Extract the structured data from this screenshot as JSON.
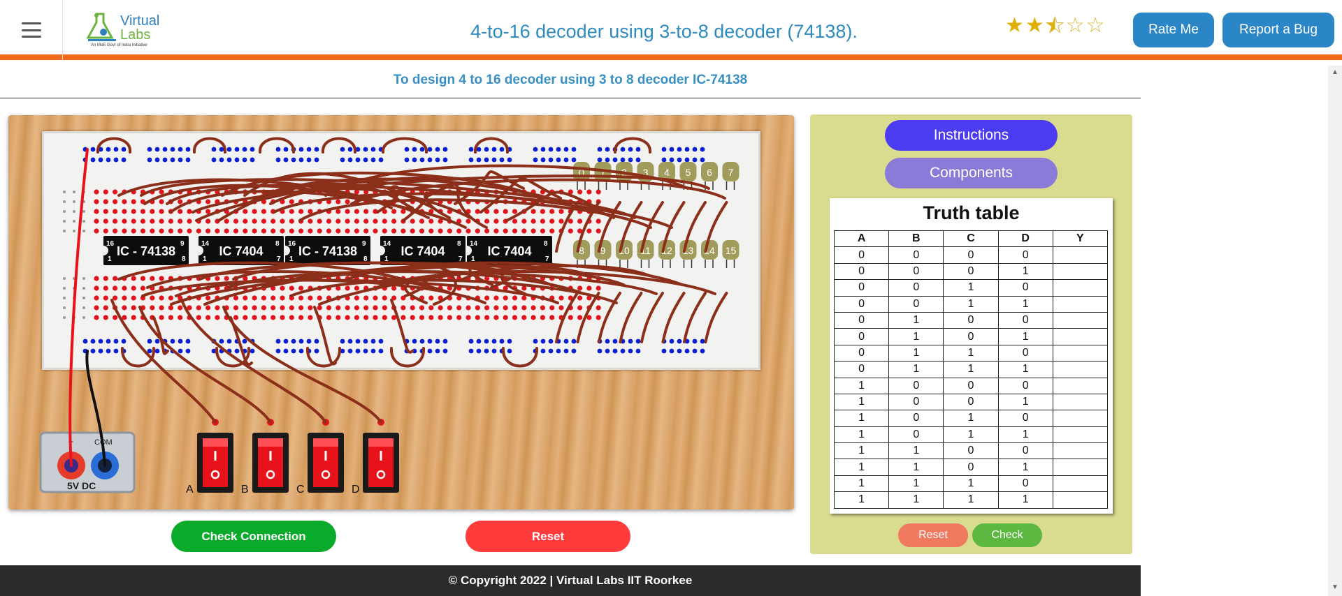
{
  "header": {
    "brand_line1": "Virtual",
    "brand_line2": "Labs",
    "brand_tagline": "An MoE Govt of India Initiative",
    "title": "4-to-16 decoder using 3-to-8 decoder (74138).",
    "rating": 2.5,
    "rating_max": 5,
    "rate_label": "Rate Me",
    "bug_label": "Report a Bug"
  },
  "aim": "To design 4 to 16 decoder using 3 to 8 decoder IC-74138",
  "chips": [
    {
      "label": "IC - 74138",
      "pin_tl": "16",
      "pin_bl": "1",
      "pin_tr": "9",
      "pin_br": "8"
    },
    {
      "label": "IC 7404",
      "pin_tl": "14",
      "pin_bl": "1",
      "pin_tr": "8",
      "pin_br": "7"
    },
    {
      "label": "IC - 74138",
      "pin_tl": "16",
      "pin_bl": "1",
      "pin_tr": "9",
      "pin_br": "8"
    },
    {
      "label": "IC 7404",
      "pin_tl": "14",
      "pin_bl": "1",
      "pin_tr": "8",
      "pin_br": "7"
    },
    {
      "label": "IC 7404",
      "pin_tl": "14",
      "pin_bl": "1",
      "pin_tr": "8",
      "pin_br": "7"
    }
  ],
  "leds_top": [
    "0",
    "1",
    "2",
    "3",
    "4",
    "5",
    "6",
    "7"
  ],
  "leds_bottom": [
    "8",
    "9",
    "10",
    "11",
    "12",
    "13",
    "14",
    "15"
  ],
  "power": {
    "plus": "+",
    "com": "COM",
    "label": "5V  DC"
  },
  "switches": [
    "A",
    "B",
    "C",
    "D"
  ],
  "buttons": {
    "check_connection": "Check Connection",
    "reset": "Reset"
  },
  "panel": {
    "instructions": "Instructions",
    "components": "Components",
    "table_title": "Truth table",
    "headers": [
      "A",
      "B",
      "C",
      "D",
      "Y"
    ],
    "rows": [
      [
        "0",
        "0",
        "0",
        "0",
        ""
      ],
      [
        "0",
        "0",
        "0",
        "1",
        ""
      ],
      [
        "0",
        "0",
        "1",
        "0",
        ""
      ],
      [
        "0",
        "0",
        "1",
        "1",
        ""
      ],
      [
        "0",
        "1",
        "0",
        "0",
        ""
      ],
      [
        "0",
        "1",
        "0",
        "1",
        ""
      ],
      [
        "0",
        "1",
        "1",
        "0",
        ""
      ],
      [
        "0",
        "1",
        "1",
        "1",
        ""
      ],
      [
        "1",
        "0",
        "0",
        "0",
        ""
      ],
      [
        "1",
        "0",
        "0",
        "1",
        ""
      ],
      [
        "1",
        "0",
        "1",
        "0",
        ""
      ],
      [
        "1",
        "0",
        "1",
        "1",
        ""
      ],
      [
        "1",
        "1",
        "0",
        "0",
        ""
      ],
      [
        "1",
        "1",
        "0",
        "1",
        ""
      ],
      [
        "1",
        "1",
        "1",
        "0",
        ""
      ],
      [
        "1",
        "1",
        "1",
        "1",
        ""
      ]
    ],
    "reset": "Reset",
    "check": "Check"
  },
  "footer": "© Copyright 2022 | Virtual Labs IIT Roorkee",
  "colors": {
    "accent_orange": "#f26a1b",
    "header_button": "#2b86c7",
    "instructions_button": "#4b3cf2",
    "components_button": "#8a7bd8",
    "check_connection": "#0aaa2a",
    "reset_main": "#ff3b3b",
    "panel_bg": "#d9db8f",
    "wire": "#8b2e1a"
  }
}
